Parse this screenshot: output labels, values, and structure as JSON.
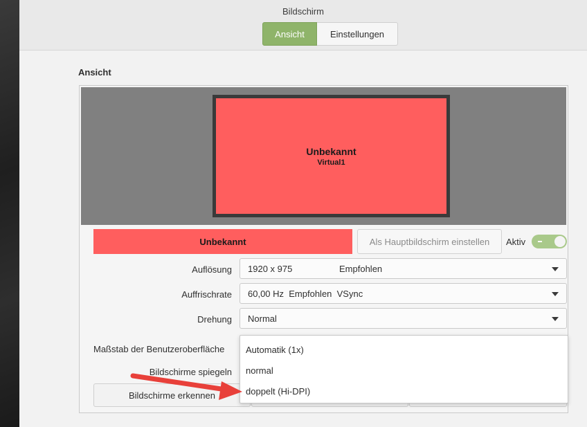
{
  "window": {
    "title": "Bildschirm"
  },
  "tabs": [
    {
      "label": "Ansicht"
    },
    {
      "label": "Einstellungen"
    }
  ],
  "section": {
    "title": "Ansicht"
  },
  "preview": {
    "monitor_name": "Unbekannt",
    "monitor_output": "Virtual1",
    "monitor_color": "#ff5e5e"
  },
  "monitor_controls": {
    "selected_name": "Unbekannt",
    "set_primary_label": "Als Hauptbildschirm einstellen",
    "active_label": "Aktiv",
    "active_on": true
  },
  "settings": {
    "resolution": {
      "label": "Auflösung",
      "value": "1920 x 975",
      "note": "Empfohlen"
    },
    "refresh": {
      "label": "Auffrischrate",
      "value": "60,00 Hz  Empfohlen  VSync"
    },
    "rotation": {
      "label": "Drehung",
      "value": "Normal"
    },
    "scale": {
      "label": "Maßstab der Benutzeroberfläche"
    },
    "mirror": {
      "label": "Bildschirme spiegeln"
    }
  },
  "buttons": {
    "detect": "Bildschirme erkennen"
  },
  "scale_dropdown": {
    "options": [
      "Automatik (1x)",
      "normal",
      "doppelt (Hi-DPI)"
    ]
  },
  "annotation": {
    "arrow_color": "#e8403a"
  }
}
